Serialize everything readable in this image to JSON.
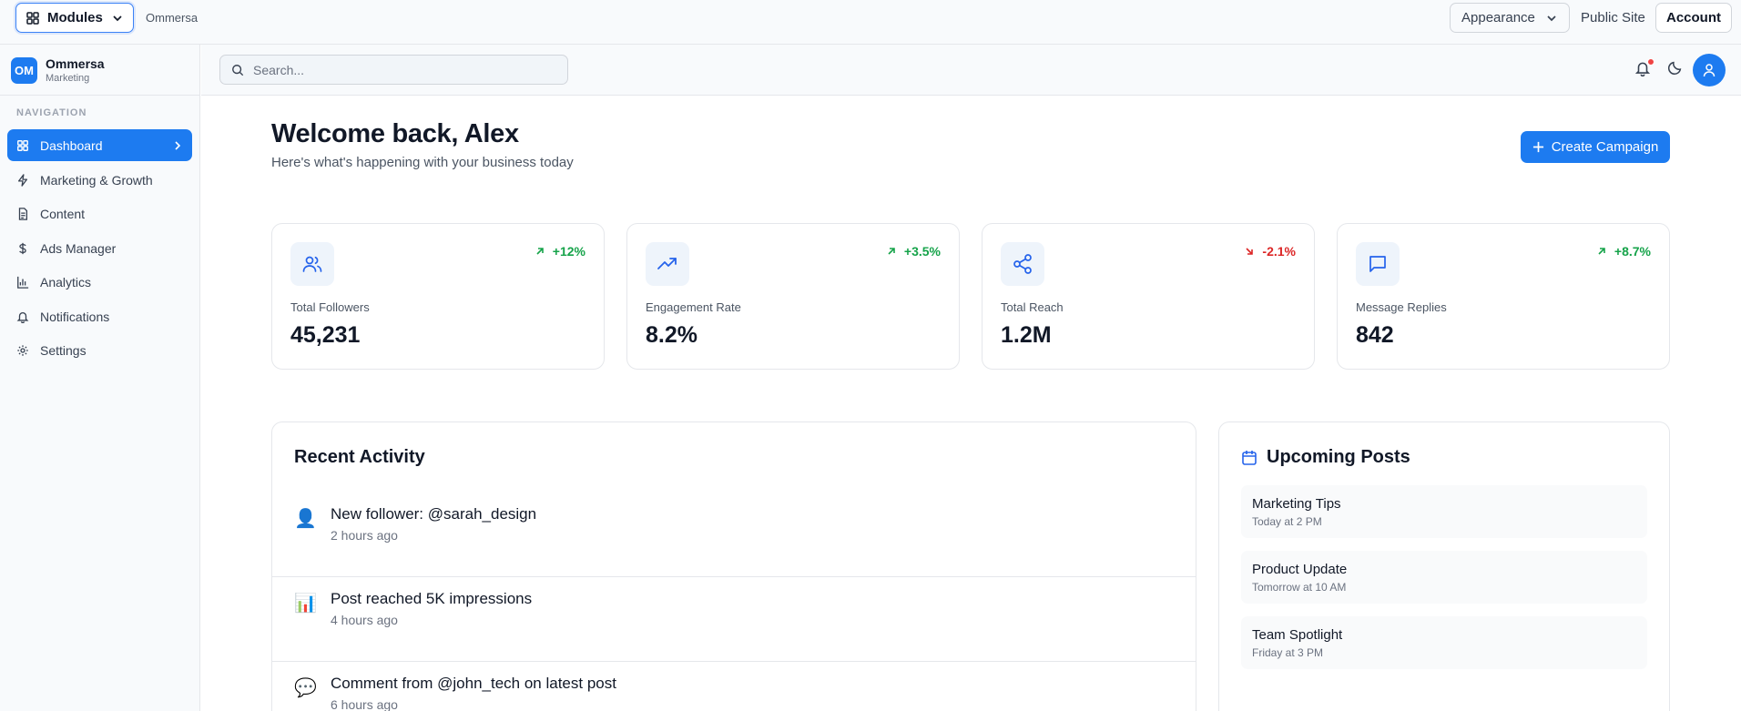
{
  "topbar": {
    "modules_label": "Modules",
    "app_name": "Ommersa",
    "appearance_label": "Appearance",
    "public_site_label": "Public Site",
    "account_label": "Account"
  },
  "sidebar": {
    "brand_initials": "OM",
    "brand_name": "Ommersa",
    "brand_sub": "Marketing",
    "nav_heading": "NAVIGATION",
    "items": [
      {
        "label": "Dashboard",
        "icon": "grid-icon",
        "active": true
      },
      {
        "label": "Marketing & Growth",
        "icon": "lightning-icon"
      },
      {
        "label": "Content",
        "icon": "document-icon"
      },
      {
        "label": "Ads Manager",
        "icon": "dollar-icon"
      },
      {
        "label": "Analytics",
        "icon": "bar-chart-icon"
      },
      {
        "label": "Notifications",
        "icon": "bell-icon"
      },
      {
        "label": "Settings",
        "icon": "gear-icon"
      }
    ]
  },
  "header": {
    "search_placeholder": "Search..."
  },
  "main": {
    "welcome": "Welcome back, Alex",
    "subtitle": "Here's what's happening with your business today",
    "create_label": "Create Campaign",
    "stats": [
      {
        "label": "Total Followers",
        "value": "45,231",
        "change": "+12%",
        "trend": "up",
        "icon": "users-icon"
      },
      {
        "label": "Engagement Rate",
        "value": "8.2%",
        "change": "+3.5%",
        "trend": "up",
        "icon": "trending-up-icon"
      },
      {
        "label": "Total Reach",
        "value": "1.2M",
        "change": "-2.1%",
        "trend": "down",
        "icon": "share-icon"
      },
      {
        "label": "Message Replies",
        "value": "842",
        "change": "+8.7%",
        "trend": "up",
        "icon": "message-icon"
      }
    ],
    "activity": {
      "title": "Recent Activity",
      "items": [
        {
          "emoji": "👤",
          "title": "New follower: @sarah_design",
          "time": "2 hours ago"
        },
        {
          "emoji": "📊",
          "title": "Post reached 5K impressions",
          "time": "4 hours ago"
        },
        {
          "emoji": "💬",
          "title": "Comment from @john_tech on latest post",
          "time": "6 hours ago"
        }
      ]
    },
    "upcoming": {
      "title": "Upcoming Posts",
      "items": [
        {
          "title": "Marketing Tips",
          "time": "Today at 2 PM"
        },
        {
          "title": "Product Update",
          "time": "Tomorrow at 10 AM"
        },
        {
          "title": "Team Spotlight",
          "time": "Friday at 3 PM"
        }
      ]
    }
  },
  "colors": {
    "accent": "#1d7bf0",
    "positive": "#16a34a",
    "negative": "#dc2626",
    "notification_dot": "#ef4444"
  }
}
